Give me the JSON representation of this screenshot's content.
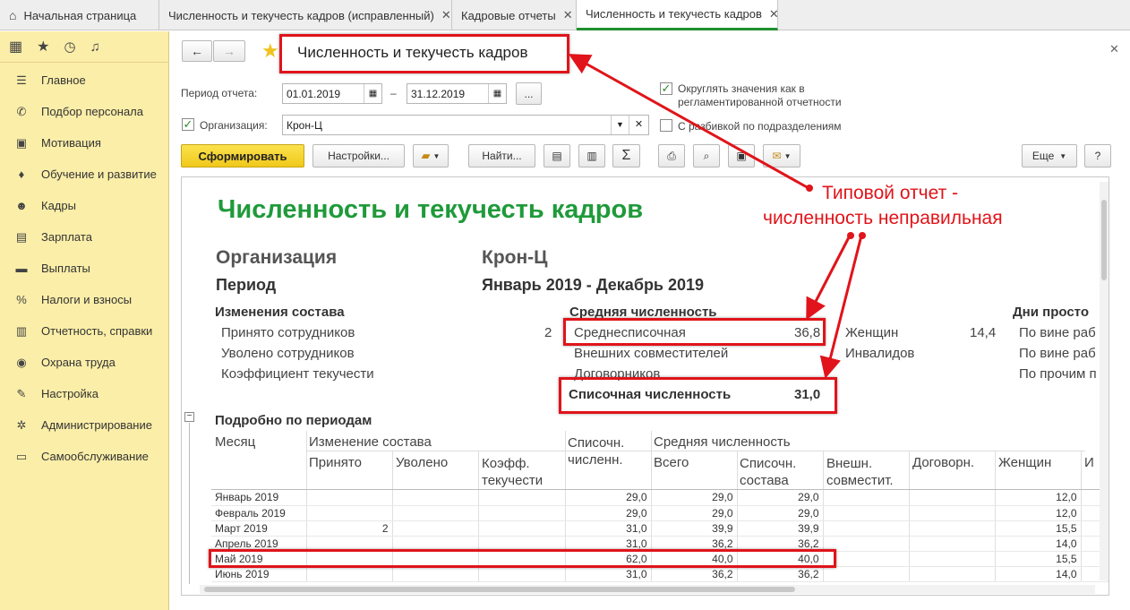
{
  "tabs": [
    {
      "label": "Начальная страница",
      "closable": false
    },
    {
      "label": "Численность и текучесть кадров (исправленный)",
      "closable": true
    },
    {
      "label": "Кадровые отчеты",
      "closable": true
    },
    {
      "label": "Численность и текучесть кадров",
      "closable": true
    }
  ],
  "sidebar": {
    "items": [
      {
        "label": "Главное",
        "icon": "menu-icon"
      },
      {
        "label": "Подбор персонала",
        "icon": "phone-icon"
      },
      {
        "label": "Мотивация",
        "icon": "gift-icon"
      },
      {
        "label": "Обучение и развитие",
        "icon": "graduation-icon"
      },
      {
        "label": "Кадры",
        "icon": "people-icon"
      },
      {
        "label": "Зарплата",
        "icon": "calculator-icon"
      },
      {
        "label": "Выплаты",
        "icon": "wallet-icon"
      },
      {
        "label": "Налоги и взносы",
        "icon": "percent-icon"
      },
      {
        "label": "Отчетность, справки",
        "icon": "report-icon"
      },
      {
        "label": "Охрана труда",
        "icon": "helmet-icon"
      },
      {
        "label": "Настройка",
        "icon": "wrench-icon"
      },
      {
        "label": "Администрирование",
        "icon": "gear-icon"
      },
      {
        "label": "Самообслуживание",
        "icon": "card-icon"
      }
    ]
  },
  "form": {
    "title": "Численность и текучесть кадров",
    "period_label": "Период отчета:",
    "date_from": "01.01.2019",
    "date_sep": "–",
    "date_to": "31.12.2019",
    "more": "...",
    "org_label": "Организация:",
    "org_value": "Крон-Ц",
    "round_label": "Округлять значения как в регламентированной отчетности",
    "subdiv_label": "С разбивкой по подразделениям"
  },
  "toolbar": {
    "generate": "Сформировать",
    "settings": "Настройки...",
    "find": "Найти...",
    "sum": "Σ",
    "more": "Еще",
    "help": "?"
  },
  "report": {
    "title": "Численность и текучесть кадров",
    "org_label": "Организация",
    "org_value": "Крон-Ц",
    "period_label": "Период",
    "period_value": "Январь 2019 - Декабрь 2019",
    "changes_header": "Изменения состава",
    "hired_label": "Принято сотрудников",
    "hired_value": "2",
    "fired_label": "Уволено сотрудников",
    "turnover_label": "Коэффициент текучести",
    "avg_header": "Средняя численность",
    "avg_list_label": "Среднесписочная",
    "avg_list_value": "36,8",
    "external_label": "Внешних совместителей",
    "contractors_label": "Договорников",
    "list_count_label": "Списочная численность",
    "list_count_value": "31,0",
    "women_label": "Женщин",
    "women_value": "14,4",
    "disabled_label": "Инвалидов",
    "downtime_header": "Дни просто",
    "downtime_1": "По вине раб",
    "downtime_2": "По вине раб",
    "downtime_3": "По прочим п",
    "detail_header": "Подробно по периодам",
    "col_month": "Месяц",
    "col_changes": "Изменение состава",
    "col_hired": "Принято",
    "col_fired": "Уволено",
    "col_coef": "Коэфф. текучести",
    "col_list": "Списочн. численн.",
    "col_avg": "Средняя численность",
    "col_total": "Всего",
    "col_list_staff": "Списочн. состава",
    "col_ext": "Внешн. совместит.",
    "col_contract": "Договорн.",
    "col_women": "Женщин",
    "col_more": "И",
    "rows": [
      {
        "month": "Январь 2019",
        "hired": "",
        "list": "29,0",
        "total": "29,0",
        "staff": "29,0",
        "women": "12,0"
      },
      {
        "month": "Февраль 2019",
        "hired": "",
        "list": "29,0",
        "total": "29,0",
        "staff": "29,0",
        "women": "12,0"
      },
      {
        "month": "Март 2019",
        "hired": "2",
        "list": "31,0",
        "total": "39,9",
        "staff": "39,9",
        "women": "15,5"
      },
      {
        "month": "Апрель 2019",
        "hired": "",
        "list": "31,0",
        "total": "36,2",
        "staff": "36,2",
        "women": "14,0"
      },
      {
        "month": "Май 2019",
        "hired": "",
        "list": "62,0",
        "total": "40,0",
        "staff": "40,0",
        "women": "15,5"
      },
      {
        "month": "Июнь 2019",
        "hired": "",
        "list": "31,0",
        "total": "36,2",
        "staff": "36,2",
        "women": "14,0"
      }
    ]
  },
  "annotation": {
    "line1": "Типовой отчет -",
    "line2": "численность неправильная"
  },
  "colors": {
    "accent_green": "#1f9a3a",
    "sidebar_bg": "#fbeea8",
    "primary_button": "#f7d530",
    "annotation_red": "#e0141a"
  }
}
